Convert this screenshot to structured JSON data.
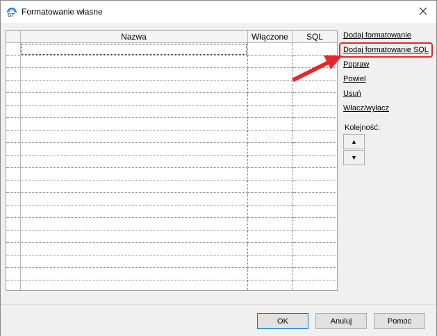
{
  "window": {
    "title": "Formatowanie własne",
    "close_glyph": "✕",
    "app_icon_text": "GT"
  },
  "grid": {
    "columns": [
      "",
      "Nazwa",
      "Włączone",
      "SQL"
    ],
    "row_count": 20
  },
  "actions": {
    "items": [
      "Dodaj formatowanie",
      "Dodaj formatowanie SQL",
      "Popraw",
      "Powiel",
      "Usuń",
      "Włacz/wyłacz"
    ],
    "highlighted_index": 1
  },
  "order": {
    "label": "Kolejność:",
    "up_glyph": "▲",
    "down_glyph": "▼"
  },
  "footer": {
    "ok_label": "OK",
    "cancel_label": "Anuluj",
    "help_label": "Pomoc"
  },
  "colors": {
    "highlight": "#e8262a",
    "arrow": "#e8262a",
    "default_button_border": "#0078d7"
  }
}
